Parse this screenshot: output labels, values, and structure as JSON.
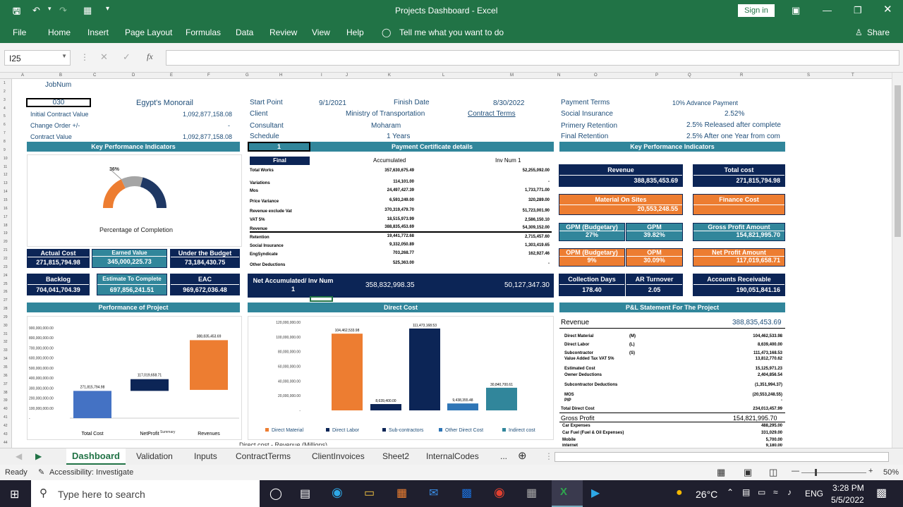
{
  "window": {
    "title": "Projects Dashboard  -  Excel",
    "signin": "Sign in"
  },
  "ribbon": {
    "tabs": [
      "File",
      "Home",
      "Insert",
      "Page Layout",
      "Formulas",
      "Data",
      "Review",
      "View",
      "Help"
    ],
    "tellme": "Tell me what you want to do",
    "share": "Share"
  },
  "formula_bar": {
    "namebox": "I25",
    "value": ""
  },
  "columns": [
    "A",
    "B",
    "C",
    "D",
    "E",
    "F",
    "G",
    "H",
    "I",
    "J",
    "K",
    "L",
    "M",
    "N",
    "O",
    "P",
    "Q",
    "R",
    "S",
    "T"
  ],
  "rows": [
    "1",
    "2",
    "3",
    "4",
    "5",
    "6",
    "7",
    "8",
    "9",
    "10",
    "11",
    "12",
    "13",
    "14",
    "15",
    "16",
    "17",
    "18",
    "19",
    "20",
    "21",
    "22",
    "23",
    "24",
    "25",
    "26",
    "27",
    "28",
    "29",
    "30",
    "31",
    "32",
    "33",
    "34",
    "35",
    "36",
    "37",
    "38",
    "39",
    "40",
    "41",
    "42",
    "43",
    "44"
  ],
  "project": {
    "jobnum_label": "JobNum",
    "jobnum": "030",
    "name": "Egypt's Monorail",
    "icv_label": "Initial Contract Value",
    "icv": "1,092,877,158.08",
    "co_label": "Change Order +/-",
    "co": "-",
    "cv_label": "Contract Value",
    "cv": "1,092,877,158.08",
    "start_label": "Start Point",
    "start": "9/1/2021",
    "finish_label": "Finish Date",
    "finish": "8/30/2022",
    "client_label": "Client",
    "client": "Ministry of Transportation",
    "contract_terms": "Contract Terms",
    "consultant_label": "Consultant",
    "consultant": "Moharam",
    "schedule_label": "Schedule",
    "schedule": "1  Years",
    "payterms_label": "Payment Terms",
    "payterms": "10% Advance Payment",
    "social_label": "Social Insurance",
    "social": "2.52%",
    "pret_label": "Primery Retention",
    "pret": "2.5% Released after complete",
    "fret_label": "Final Retention",
    "fret": "2.5% After one Year from com"
  },
  "kpi_left": {
    "header": "Key Performance Indicators",
    "gauge_pct": "36%",
    "gauge_value": 0.36,
    "gauge_label": "Percentage of Completion",
    "actual_cost_label": "Actual Cost",
    "actual_cost": "271,815,794.98",
    "earned_label": "Earned Value",
    "earned": "345,000,225.73",
    "budget_label": "Under the Budget",
    "budget": "73,184,430.75",
    "backlog_label": "Backlog",
    "backlog": "704,041,704.39",
    "etc_label": "Estimate To Complete",
    "etc": "697,856,241.51",
    "eac_label": "EAC",
    "eac": "969,672,036.48"
  },
  "payment": {
    "selector": "1",
    "header": "Payment Certificate details",
    "final": "Final",
    "acc_label": "Accumulated",
    "inv_label": "Inv Num 1",
    "rows": [
      {
        "label": "Total Works",
        "acc": "357,630,675.49",
        "inv": "52,255,092.00"
      },
      {
        "label": "Variations",
        "acc": "114,101.00",
        "inv": "-"
      },
      {
        "label": "Mos",
        "acc": "24,497,427.39",
        "inv": "1,733,771.00"
      },
      {
        "label": "Price Variance",
        "acc": "6,593,249.00",
        "inv": "320,289.00"
      },
      {
        "label": "Revenue exclude Vat",
        "acc": "370,319,479.70",
        "inv": "51,723,001.90"
      },
      {
        "label": "VAT 5%",
        "acc": "18,515,973.99",
        "inv": "2,586,150.10"
      },
      {
        "label": "Revenue",
        "acc": "388,835,453.69",
        "inv": "54,309,152.00"
      },
      {
        "label": "Retention",
        "acc": "19,441,772.68",
        "inv": "2,715,457.60"
      },
      {
        "label": "Social Insurance",
        "acc": "9,332,050.89",
        "inv": "1,303,419.65"
      },
      {
        "label": "EngSyndicate",
        "acc": "703,268.77",
        "inv": "162,927.46"
      },
      {
        "label": "Other Deductions",
        "acc": "525,363.00",
        "inv": "-"
      }
    ],
    "net_label": "Net  Accumulated/ Inv Num 1",
    "net_acc": "358,832,998.35",
    "net_inv": "50,127,347.30"
  },
  "kpi_right": {
    "header": "Key Performance Indicators",
    "revenue_label": "Revenue",
    "revenue": "388,835,453.69",
    "total_cost_label": "Total cost",
    "total_cost": "271,815,794.98",
    "mos_label": "Material On Sites",
    "mos": "20,553,248.55",
    "finance_label": "Finance Cost",
    "finance": "",
    "gpm_b_label": "GPM (Budgetary)",
    "gpm_b": "27%",
    "gpm_label": "GPM",
    "gpm": "39.82%",
    "gpa_label": "Gross Profit Amount",
    "gpa": "154,821,995.70",
    "opm_b_label": "OPM (Budgetary)",
    "opm_b": "9%",
    "opm_label": "OPM",
    "opm": "30.09%",
    "npa_label": "Net Profit Amount",
    "npa": "117,019,658.71",
    "cd_label": "Collection Days",
    "cd": "178.40",
    "ar_label": "AR Turnover",
    "ar": "2.05",
    "acr_label": "Accounts Receivable",
    "acr": "190,051,841.16"
  },
  "perf_chart": {
    "header": "Performance of Project",
    "summary": "Summary"
  },
  "direct_chart": {
    "header": "Direct Cost",
    "footer_label": "Direct cost - Revenue (Millions)"
  },
  "chart_data": [
    {
      "type": "bar",
      "title": "",
      "xlabel": "Summary",
      "ylim": [
        0,
        900000000
      ],
      "yticks": [
        "900,000,000.00",
        "800,000,000.00",
        "700,000,000.00",
        "600,000,000.00",
        "500,000,000.00",
        "400,000,000.00",
        "300,000,000.00",
        "200,000,000.00",
        "100,000,000.00",
        "-"
      ],
      "categories": [
        "Total Cost",
        "NetProfit",
        "Revenues"
      ],
      "values": [
        271815794.98,
        117019658.71,
        388835453.69
      ],
      "labels": [
        "271,815,794.98",
        "117,019,658.71",
        "388,835,453.69"
      ],
      "colors": [
        "#4472c4",
        "#0c2556",
        "#ed7d31"
      ]
    },
    {
      "type": "bar",
      "title": "",
      "ylim": [
        0,
        120000000
      ],
      "yticks": [
        "120,000,000.00",
        "100,000,000.00",
        "80,000,000.00",
        "60,000,000.00",
        "40,000,000.00",
        "20,000,000.00",
        "-"
      ],
      "series": [
        {
          "name": "Direct Material",
          "value": 104462533.98,
          "label": "104,462,533.98",
          "color": "#ed7d31"
        },
        {
          "name": "Direct Labor",
          "value": 8639400.0,
          "label": "8,639,400.00",
          "color": "#0c2556"
        },
        {
          "name": "Sub-contractors",
          "value": 111473168.53,
          "label": "111,473,168.53",
          "color": "#0c2556"
        },
        {
          "name": "Other Direct Cost",
          "value": 9438355.48,
          "label": "9,438,355.48",
          "color": "#2e75b6"
        },
        {
          "name": "Indirect cost",
          "value": 30840700.61,
          "label": "30,840,700.61",
          "color": "#31869b"
        }
      ]
    }
  ],
  "pl": {
    "header": "P&L Statement For The Project",
    "revenue_label": "Revenue",
    "revenue": "388,835,453.69",
    "rows": [
      {
        "label": "Direct Material",
        "code": "(M)",
        "value": "104,462,533.98"
      },
      {
        "label": "Direct Labor",
        "code": "(L)",
        "value": "8,639,400.00"
      },
      {
        "label": "Subcontractor",
        "code": "(S)",
        "value": "111,473,168.53"
      },
      {
        "label": "Value Added Tax VAT 5%",
        "code": "",
        "value": "13,812,770.62"
      },
      {
        "label": "Estimated Cost",
        "code": "",
        "value": "15,125,971.23"
      },
      {
        "label": "Owner Deductions",
        "code": "",
        "value": "2,404,856.54"
      },
      {
        "label": "Subcontractor Deductions",
        "code": "",
        "value": "(1,351,994.37)"
      },
      {
        "label": "MOS",
        "code": "",
        "value": "(20,553,248.55)"
      },
      {
        "label": "PIP",
        "code": "",
        "value": "-"
      },
      {
        "label": "Total Direct Cost",
        "code": "",
        "value": "234,013,457.99"
      }
    ],
    "gp_label": "Gross Profit",
    "gp": "154,821,995.70",
    "exp": [
      {
        "label": "Car Expenses",
        "value": "488,295.00"
      },
      {
        "label": "Car Fuel (Fuel & Oil Expenses)",
        "value": "331,029.00"
      },
      {
        "label": "Mobile",
        "value": "5,700.00"
      },
      {
        "label": "Internet",
        "value": "9,180.00"
      }
    ]
  },
  "sheet_tabs": [
    "Dashboard",
    "Validation",
    "Inputs",
    "ContractTerms",
    "ClientInvoices",
    "Sheet2",
    "InternalCodes",
    "..."
  ],
  "status": {
    "ready": "Ready",
    "accessibility": "Accessibility: Investigate",
    "zoom": "50%"
  },
  "taskbar": {
    "search": "Type here to search",
    "temp": "26°C",
    "lang": "ENG",
    "time": "3:28 PM",
    "date": "5/5/2022"
  }
}
